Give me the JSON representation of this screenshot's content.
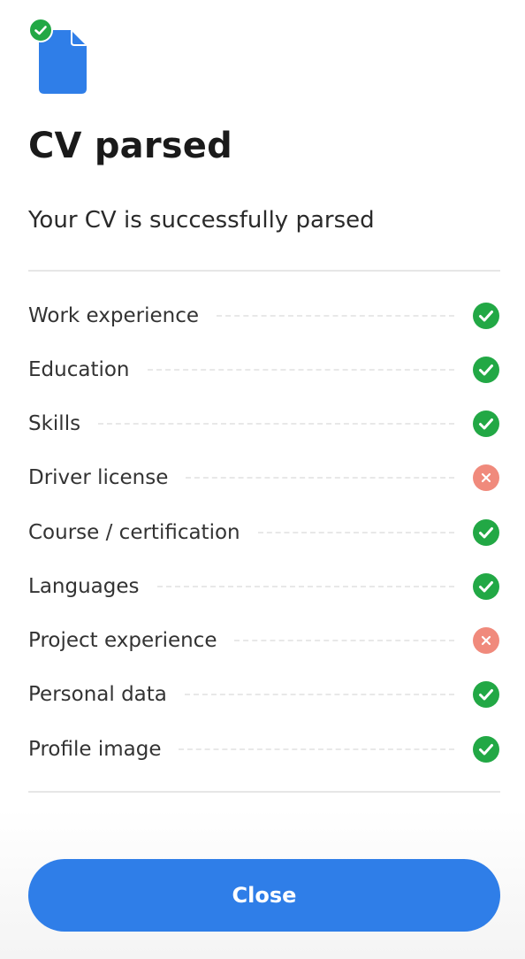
{
  "header": {
    "title": "CV parsed",
    "subtitle": "Your CV is successfully parsed"
  },
  "colors": {
    "accent": "#2f7ee8",
    "success": "#22a845",
    "error": "#f08a7c"
  },
  "icons": {
    "document": "document-icon",
    "badge": "check-badge-icon",
    "ok": "check-circle-icon",
    "fail": "x-circle-icon"
  },
  "sections": [
    {
      "label": "Work experience",
      "status": "ok"
    },
    {
      "label": "Education",
      "status": "ok"
    },
    {
      "label": "Skills",
      "status": "ok"
    },
    {
      "label": "Driver license",
      "status": "fail"
    },
    {
      "label": "Course / certification",
      "status": "ok"
    },
    {
      "label": "Languages",
      "status": "ok"
    },
    {
      "label": "Project experience",
      "status": "fail"
    },
    {
      "label": "Personal data",
      "status": "ok"
    },
    {
      "label": "Profile image",
      "status": "ok"
    }
  ],
  "footer": {
    "close_label": "Close"
  }
}
